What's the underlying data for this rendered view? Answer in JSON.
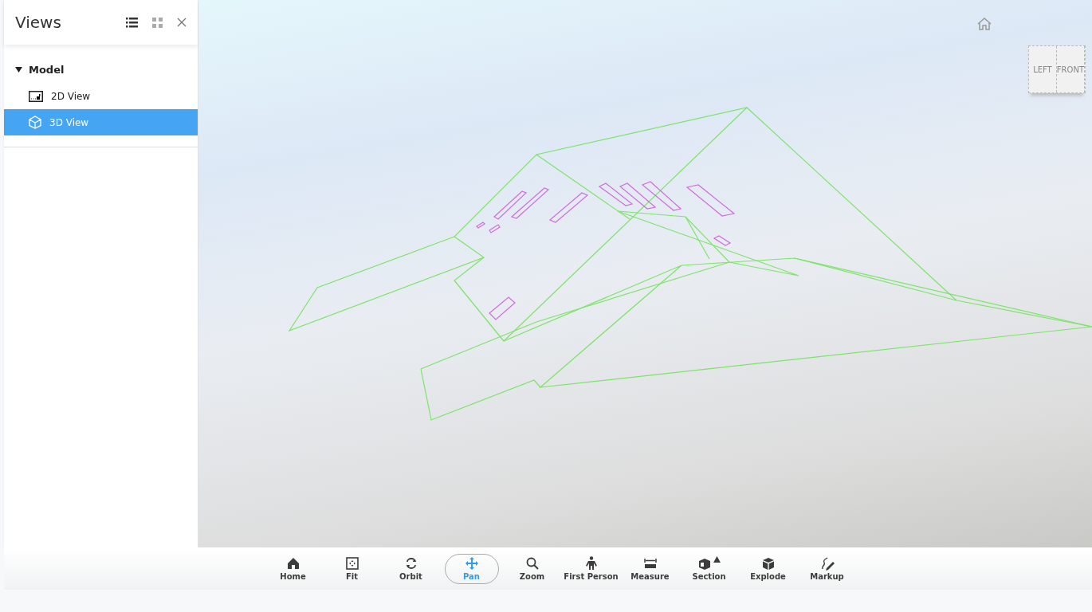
{
  "panel": {
    "title": "Views",
    "view_modes": [
      {
        "kind": "list",
        "selected": true
      },
      {
        "kind": "grid",
        "selected": false
      }
    ]
  },
  "tree": [
    {
      "label": "Model",
      "expanded": true,
      "selected": false,
      "children": [
        {
          "label": "2D View",
          "kind": "sheet",
          "selected": false
        },
        {
          "label": "3D View",
          "kind": "cube",
          "selected": true
        }
      ]
    }
  ],
  "viewcube": {
    "faces": [
      "LEFT",
      "FRONT"
    ]
  },
  "toolbar": [
    {
      "label": "Home",
      "selected": false,
      "menu": false
    },
    {
      "label": "Fit",
      "selected": false,
      "menu": false
    },
    {
      "label": "Orbit",
      "selected": false,
      "menu": false
    },
    {
      "label": "Pan",
      "selected": true,
      "menu": false
    },
    {
      "label": "Zoom",
      "selected": false,
      "menu": false
    },
    {
      "label": "First Person",
      "selected": false,
      "menu": false
    },
    {
      "label": "Measure",
      "selected": false,
      "menu": false
    },
    {
      "label": "Section",
      "selected": false,
      "menu": true
    },
    {
      "label": "Explode",
      "selected": false,
      "menu": false
    },
    {
      "label": "Markup",
      "selected": false,
      "menu": false
    }
  ]
}
